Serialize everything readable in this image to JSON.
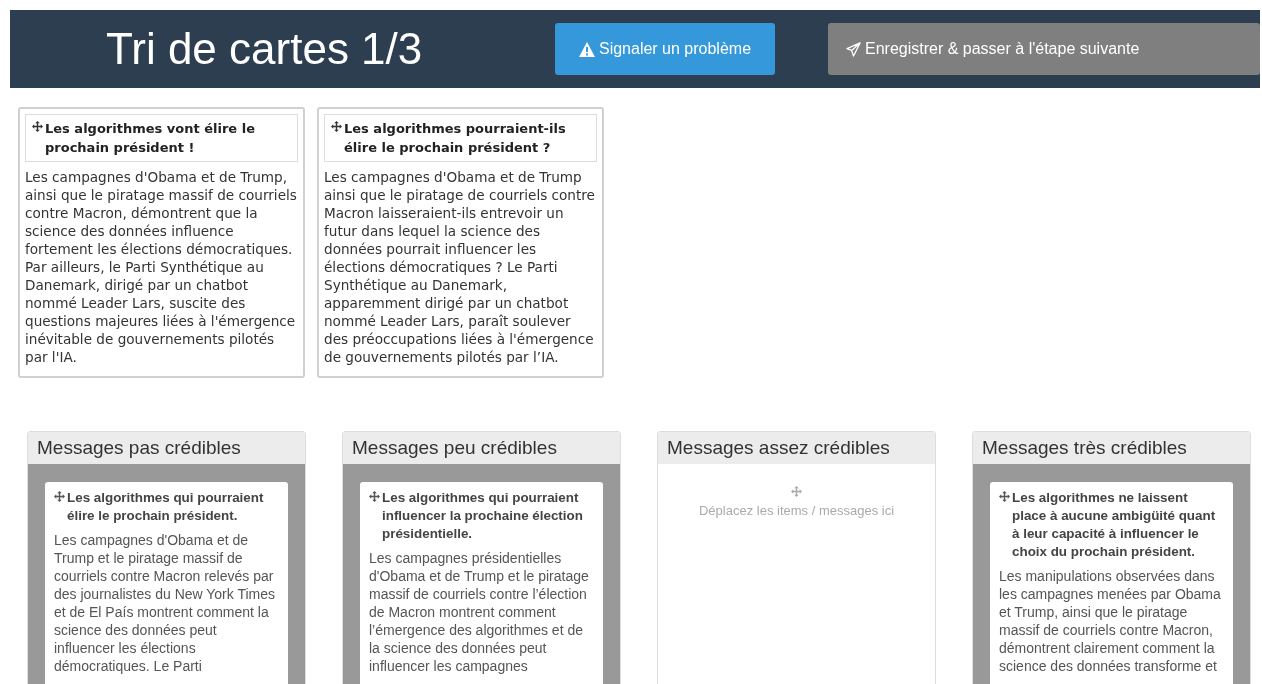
{
  "header": {
    "title": "Tri de cartes 1/3",
    "buttons": [
      {
        "kind": "report",
        "label": "Signaler un problème"
      },
      {
        "kind": "next",
        "label": "Enregistrer & passer à l'étape suivante"
      }
    ]
  },
  "unsorted_cards": [
    {
      "title": "Les algorithmes vont élire le prochain président !",
      "body": "Les campagnes d'Obama et de Trump, ainsi que le piratage massif de courriels contre Macron, démontrent que la science des données influence fortement les élections démocratiques. Par ailleurs, le Parti Synthétique au Danemark, dirigé par un chatbot nommé Leader Lars, suscite des questions majeures liées à l'émergence inévitable de gouvernements pilotés par l'IA."
    },
    {
      "title": "Les algorithmes pourraient-ils élire le prochain président ?",
      "body": "Les campagnes d'Obama et de Trump ainsi que le piratage de courriels contre Macron laisseraient-ils entrevoir un futur dans lequel la science des données pourrait influencer les élections démocratiques ? Le Parti Synthétique au Danemark, apparemment dirigé par un chatbot nommé Leader Lars, paraît soulever des préoccupations liées à l'émergence de gouvernements pilotés par l’IA."
    }
  ],
  "columns": [
    {
      "title": "Messages pas crédibles",
      "cards": [
        {
          "title": "Les algorithmes qui pourraient élire le prochain président.",
          "body": "Les campagnes d'Obama et de Trump et le piratage massif de courriels contre Macron relevés par des journalistes du New York Times et de El País montrent comment la science des données peut influencer les élections démocratiques. Le Parti"
        }
      ]
    },
    {
      "title": "Messages peu crédibles",
      "cards": [
        {
          "title": "Les algorithmes qui pourraient influencer la prochaine élection présidentielle.",
          "body": "Les campagnes présidentielles d'Obama et de Trump et le piratage massif de courriels contre l’élection de Macron montrent comment l’émergence des algorithmes et de la science des données peut influencer les campagnes"
        }
      ]
    },
    {
      "title": "Messages assez crédibles",
      "empty_hint": "Déplacez les items / messages ici"
    },
    {
      "title": "Messages très crédibles",
      "cards": [
        {
          "title": "Les algorithmes ne laissent place à aucune ambigüité quant à leur capacité à influencer le choix du prochain président.",
          "body": "Les manipulations observées dans les campagnes menées par Obama et Trump, ainsi que le piratage massif de courriels contre Macron, démontrent clairement comment la science des données transforme et"
        }
      ]
    }
  ]
}
